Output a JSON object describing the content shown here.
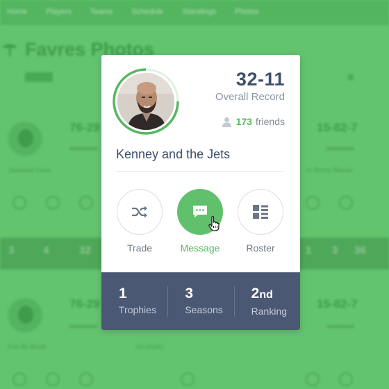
{
  "background": {
    "nav_items": [
      "Home",
      "Players",
      "Teams",
      "Schedule",
      "Standings",
      "Photos"
    ],
    "page_title": "Favres Photos",
    "records": [
      "76-29",
      "15-82-7",
      "76-29",
      "15-82-7"
    ],
    "team_names": [
      "Seahawk Crew",
      "Jo Benny Blanko",
      "Fun Bo Bowls",
      "Go Ducks"
    ],
    "strip_values": [
      "3",
      "4",
      "32",
      "1",
      "3",
      "36"
    ]
  },
  "card": {
    "record": "32-11",
    "record_label": "Overall Record",
    "friends_count": "173",
    "friends_label": "friends",
    "team_name": "Kenney and the Jets",
    "actions": [
      {
        "label": "Trade",
        "icon": "shuffle-icon"
      },
      {
        "label": "Message",
        "icon": "chat-bubble-icon"
      },
      {
        "label": "Roster",
        "icon": "list-grid-icon"
      }
    ],
    "stats": [
      {
        "value": "1",
        "suffix": "",
        "label": "Trophies"
      },
      {
        "value": "3",
        "suffix": "",
        "label": "Seasons"
      },
      {
        "value": "2",
        "suffix": "nd",
        "label": "Ranking"
      }
    ]
  },
  "colors": {
    "accent_green": "#61c06c",
    "background_green": "#63c46f",
    "navy": "#4b5874",
    "text_dark": "#3d4f6b"
  }
}
